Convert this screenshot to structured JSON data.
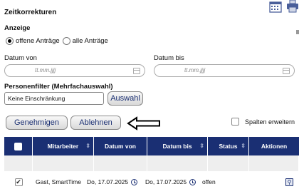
{
  "page": {
    "title": "Zeitkorrekturen"
  },
  "anzeige": {
    "label": "Anzeige",
    "options": [
      {
        "label": "offene Anträge",
        "checked": true
      },
      {
        "label": "alle Anträge",
        "checked": false
      }
    ]
  },
  "date_von": {
    "label": "Datum von",
    "placeholder": "tt.mm.jjjj",
    "value": ""
  },
  "date_bis": {
    "label": "Datum bis",
    "placeholder": "tt.mm.jjjj",
    "value": ""
  },
  "personenfilter": {
    "label": "Personenfilter (Mehrfachauswahl)",
    "value": "Keine Einschränkung",
    "button_label": "Auswahl"
  },
  "actions": {
    "approve_label": "Genehmigen",
    "reject_label": "Ablehnen"
  },
  "spalten": {
    "label": "Spalten erweitern",
    "checked": false
  },
  "table": {
    "columns": [
      "",
      "Mitarbeiter",
      "Datum von",
      "Datum bis",
      "Status",
      "Aktionen"
    ],
    "rows": [
      {
        "checked": true,
        "mitarbeiter": "Gast, SmartTime",
        "datum_von": "Do, 17.07.2025",
        "datum_bis": "Do, 17.07.2025",
        "status": "offen"
      }
    ]
  },
  "colors": {
    "header_bg": "#1a2f73",
    "button_text": "#1a2f73"
  },
  "icons": [
    "calendar-icon",
    "print-icon",
    "clock-icon",
    "magnifier-icon",
    "arrow-icon"
  ]
}
